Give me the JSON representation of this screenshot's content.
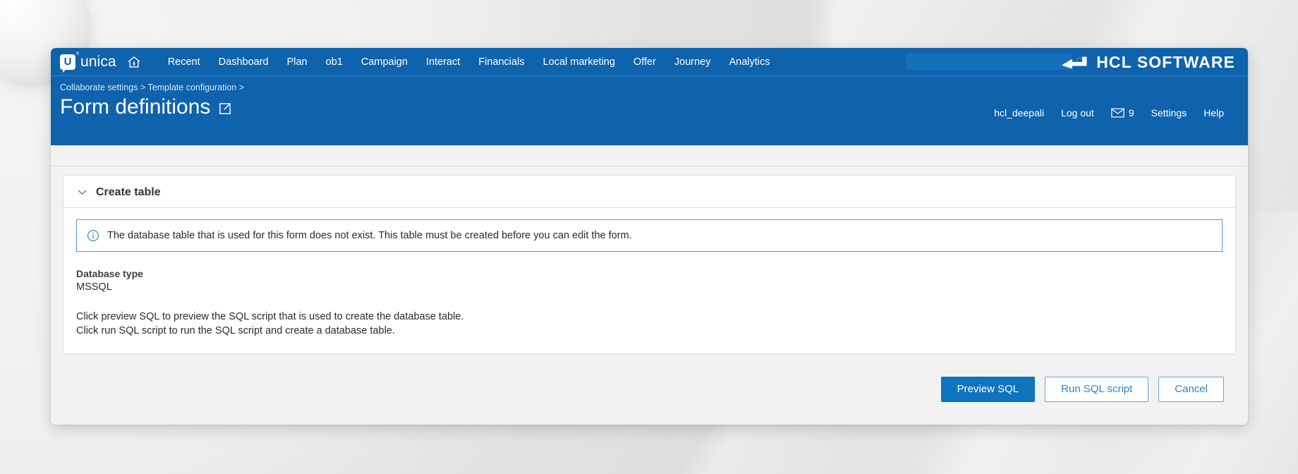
{
  "colors": {
    "header_blue": "#0f62ac",
    "accent_blue": "#0f73bd",
    "link_blue": "#2d83c6",
    "info_border": "#4f9ad6",
    "panel_gray": "#f2f2f2"
  },
  "topnav": {
    "brand_letter": "U",
    "brand_registered": "®",
    "brand_name": "unica",
    "home_icon": "home-icon",
    "links": [
      {
        "label": "Recent"
      },
      {
        "label": "Dashboard"
      },
      {
        "label": "Plan"
      },
      {
        "label": "ob1"
      },
      {
        "label": "Campaign"
      },
      {
        "label": "Interact"
      },
      {
        "label": "Financials"
      },
      {
        "label": "Local marketing"
      },
      {
        "label": "Offer"
      },
      {
        "label": "Journey"
      },
      {
        "label": "Analytics"
      }
    ],
    "search": {
      "value": "",
      "placeholder": "",
      "icon": "search-icon"
    },
    "corp_logo": {
      "icon": "hcl-arrow-logo",
      "text": "HCL SOFTWARE"
    }
  },
  "pagehead": {
    "breadcrumb": "Collaborate settings > Template configuration >",
    "title": "Form definitions",
    "title_icon": "external-link-icon",
    "account": {
      "username": "hcl_deepali",
      "logout": "Log out",
      "mail_icon": "envelope-icon",
      "mail_count": "9",
      "settings": "Settings",
      "help": "Help"
    }
  },
  "card": {
    "collapse_icon": "chevron-down-icon",
    "title": "Create table",
    "info": {
      "icon": "info-circle-icon",
      "text": "The database table that is used for this form does not exist. This table must be created before you can edit the form."
    },
    "database_type": {
      "label": "Database type",
      "value": "MSSQL"
    },
    "instructions": [
      "Click preview SQL to preview the SQL script that is used to create the database table.",
      "Click run SQL script to run the SQL script and create a database table."
    ]
  },
  "footer": {
    "buttons": [
      {
        "label": "Preview SQL",
        "style": "primary"
      },
      {
        "label": "Run SQL script",
        "style": "secondary"
      },
      {
        "label": "Cancel",
        "style": "secondary"
      }
    ]
  }
}
